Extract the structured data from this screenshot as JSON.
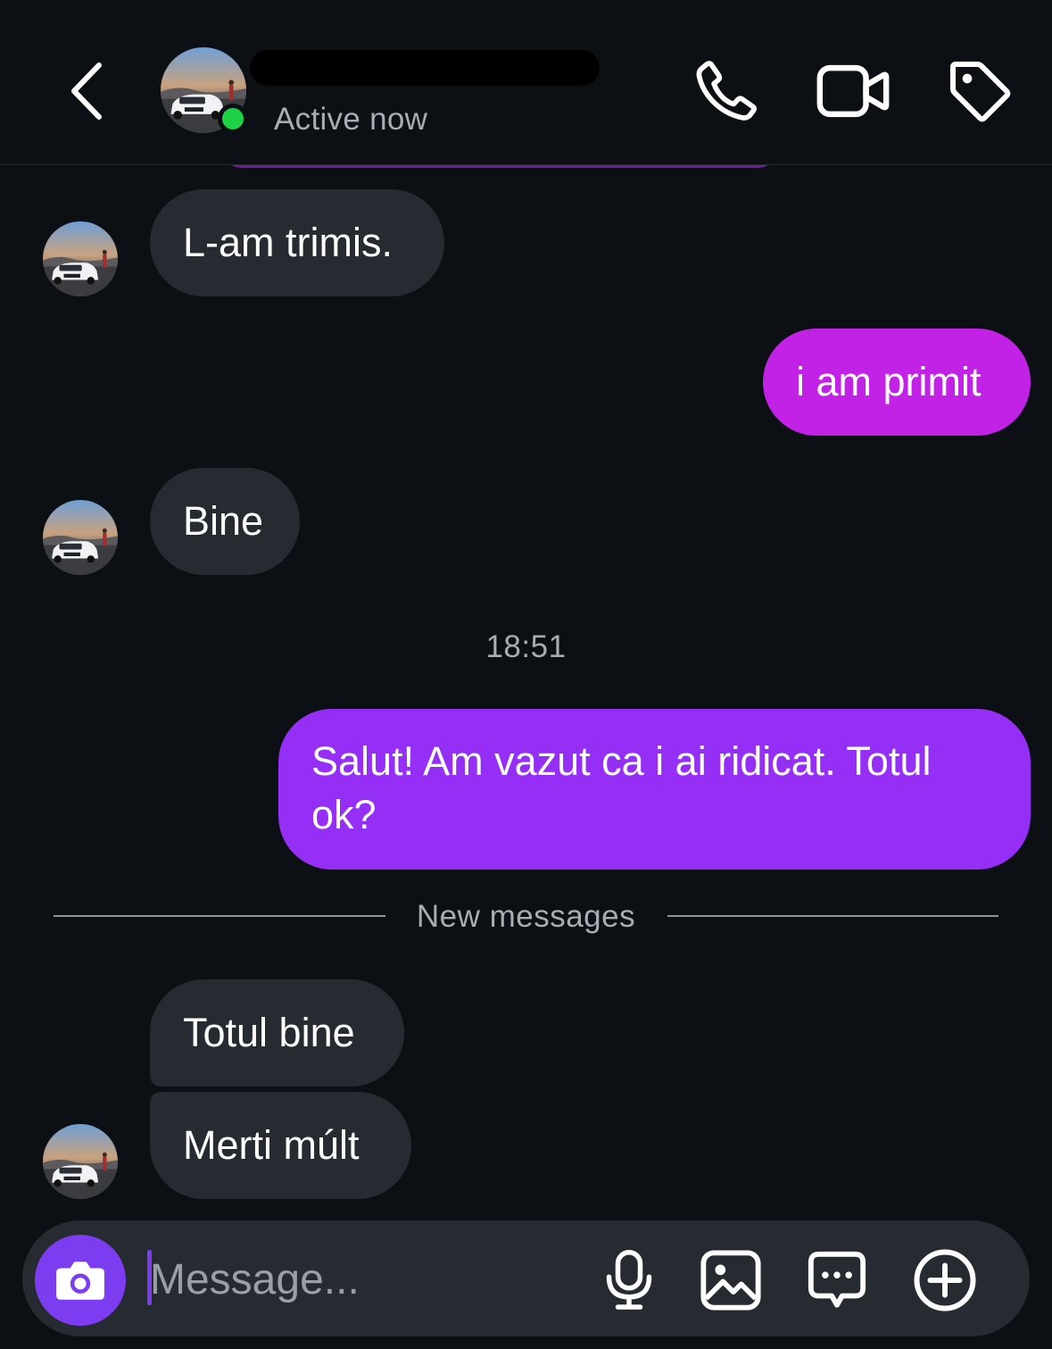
{
  "header": {
    "contact_name": "",
    "status": "Active now",
    "icons": {
      "back": "chevron-left-icon",
      "avatar": "avatar-photo",
      "call": "phone-icon",
      "video": "video-camera-icon",
      "tag": "tag-icon"
    }
  },
  "messages": [
    {
      "direction": "incoming",
      "text": "L-am trimis."
    },
    {
      "direction": "outgoing",
      "text": "i am primit"
    },
    {
      "direction": "incoming",
      "text": "Bine"
    },
    {
      "direction": "timestamp",
      "text": "18:51"
    },
    {
      "direction": "outgoing",
      "text": "Salut! Am vazut ca i ai ridicat. Totul ok?"
    },
    {
      "direction": "divider",
      "text": "New messages"
    },
    {
      "direction": "incoming",
      "text": "Totul bine"
    },
    {
      "direction": "incoming",
      "text": "Merti múlt"
    }
  ],
  "composer": {
    "placeholder": "Message...",
    "icons": {
      "camera": "camera-icon",
      "mic": "microphone-icon",
      "gallery": "image-icon",
      "sticker": "chat-bubble-icon",
      "plus": "plus-circle-icon"
    }
  },
  "colors": {
    "background": "#0c1014",
    "incoming_bubble": "#262a31",
    "outgoing_bubble_pink": "#c222e6",
    "outgoing_bubble_purple": "#962ff5",
    "online_dot": "#1ed246",
    "camera_button": "#7c3cf0",
    "secondary_text": "#a8acb3"
  }
}
